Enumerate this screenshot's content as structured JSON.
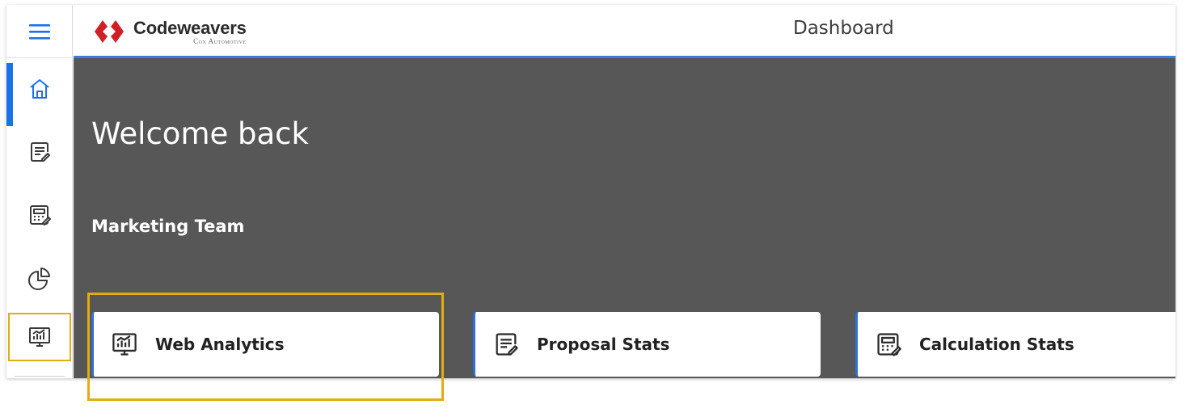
{
  "app": {
    "brand_name": "Codeweavers",
    "brand_sub": "Cox Automotive",
    "page_title": "Dashboard"
  },
  "sidebar": {
    "items": [
      {
        "name": "home",
        "icon": "home-icon"
      },
      {
        "name": "proposals",
        "icon": "document-edit-icon"
      },
      {
        "name": "calculations",
        "icon": "calculator-icon"
      },
      {
        "name": "reports",
        "icon": "pie-chart-icon"
      },
      {
        "name": "web-analytics",
        "icon": "analytics-monitor-icon"
      }
    ]
  },
  "main": {
    "welcome": "Welcome back",
    "team": "Marketing Team",
    "cards": [
      {
        "label": "Web Analytics",
        "icon": "analytics-monitor-icon"
      },
      {
        "label": "Proposal Stats",
        "icon": "document-edit-icon"
      },
      {
        "label": "Calculation Stats",
        "icon": "calculator-icon"
      }
    ]
  },
  "colors": {
    "accent": "#1a73e8",
    "highlight": "#e2ac12",
    "hero_bg": "#575757",
    "brand_red": "#d21f26"
  }
}
